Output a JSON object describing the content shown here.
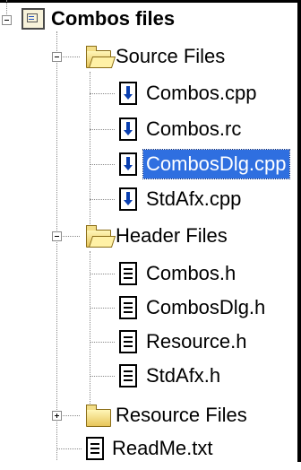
{
  "tree": {
    "project": {
      "label": "Combos files"
    },
    "source_files": {
      "label": "Source Files",
      "items": [
        "Combos.cpp",
        "Combos.rc",
        "CombosDlg.cpp",
        "StdAfx.cpp"
      ],
      "selected": "CombosDlg.cpp"
    },
    "header_files": {
      "label": "Header Files",
      "items": [
        "Combos.h",
        "CombosDlg.h",
        "Resource.h",
        "StdAfx.h"
      ]
    },
    "resource_files": {
      "label": "Resource Files"
    },
    "readme": {
      "label": "ReadMe.txt"
    }
  },
  "colors": {
    "selection": "#2f6fe0",
    "connector": "#8a8a8a"
  }
}
